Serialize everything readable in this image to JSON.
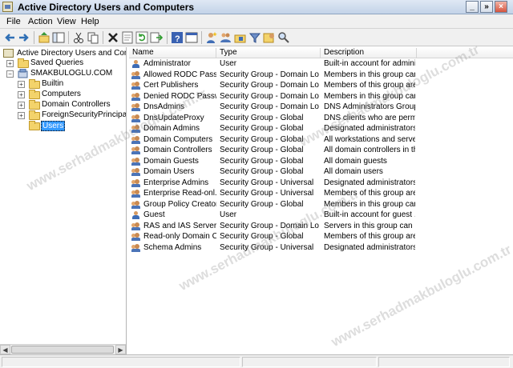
{
  "window": {
    "title": "Active Directory Users and Computers",
    "minimize_glyph": "_",
    "restore_glyph": "»",
    "close_glyph": "×"
  },
  "menu": [
    "File",
    "Action",
    "View",
    "Help"
  ],
  "toolbar_icons": [
    "back-icon",
    "forward-icon",
    "up-icon",
    "show-console-tree-icon",
    "cut-icon",
    "copy-icon",
    "delete-icon",
    "properties-icon",
    "refresh-icon",
    "export-list-icon",
    "help-icon",
    "console-icon",
    "new-user-icon",
    "new-group-icon",
    "new-ou-icon",
    "filter-icon",
    "add-to-group-icon",
    "find-icon"
  ],
  "tree": {
    "root": "Active Directory Users and Comput",
    "saved_queries": "Saved Queries",
    "domain": "SMAKBULOGLU.COM",
    "children": [
      "Builtin",
      "Computers",
      "Domain Controllers",
      "ForeignSecurityPrincipals",
      "Users"
    ],
    "selected": "Users",
    "expand_glyph": "+",
    "collapse_glyph": "−"
  },
  "columns": [
    "Name",
    "Type",
    "Description"
  ],
  "rows": [
    {
      "name": "Administrator",
      "type": "User",
      "desc": "Built-in account for admini...",
      "icon": "user"
    },
    {
      "name": "Allowed RODC Pass...",
      "type": "Security Group - Domain Local",
      "desc": "Members in this group can...",
      "icon": "group"
    },
    {
      "name": "Cert Publishers",
      "type": "Security Group - Domain Local",
      "desc": "Members of this group are...",
      "icon": "group"
    },
    {
      "name": "Denied RODC Passw...",
      "type": "Security Group - Domain Local",
      "desc": "Members in this group can...",
      "icon": "group"
    },
    {
      "name": "DnsAdmins",
      "type": "Security Group - Domain Local",
      "desc": "DNS Administrators Group",
      "icon": "group"
    },
    {
      "name": "DnsUpdateProxy",
      "type": "Security Group - Global",
      "desc": "DNS clients who are permi...",
      "icon": "group"
    },
    {
      "name": "Domain Admins",
      "type": "Security Group - Global",
      "desc": "Designated administrators...",
      "icon": "group"
    },
    {
      "name": "Domain Computers",
      "type": "Security Group - Global",
      "desc": "All workstations and serve...",
      "icon": "group"
    },
    {
      "name": "Domain Controllers",
      "type": "Security Group - Global",
      "desc": "All domain controllers in th...",
      "icon": "group"
    },
    {
      "name": "Domain Guests",
      "type": "Security Group - Global",
      "desc": "All domain guests",
      "icon": "group"
    },
    {
      "name": "Domain Users",
      "type": "Security Group - Global",
      "desc": "All domain users",
      "icon": "group"
    },
    {
      "name": "Enterprise Admins",
      "type": "Security Group - Universal",
      "desc": "Designated administrators...",
      "icon": "group"
    },
    {
      "name": "Enterprise Read-onl...",
      "type": "Security Group - Universal",
      "desc": "Members of this group are...",
      "icon": "group"
    },
    {
      "name": "Group Policy Creator...",
      "type": "Security Group - Global",
      "desc": "Members in this group can...",
      "icon": "group"
    },
    {
      "name": "Guest",
      "type": "User",
      "desc": "Built-in account for guest ...",
      "icon": "user"
    },
    {
      "name": "RAS and IAS Servers",
      "type": "Security Group - Domain Local",
      "desc": "Servers in this group can ...",
      "icon": "group"
    },
    {
      "name": "Read-only Domain C...",
      "type": "Security Group - Global",
      "desc": "Members of this group are...",
      "icon": "group"
    },
    {
      "name": "Schema Admins",
      "type": "Security Group - Universal",
      "desc": "Designated administrators...",
      "icon": "group"
    }
  ],
  "watermark_text": "www.serhadmakbuloglu.com.tr"
}
